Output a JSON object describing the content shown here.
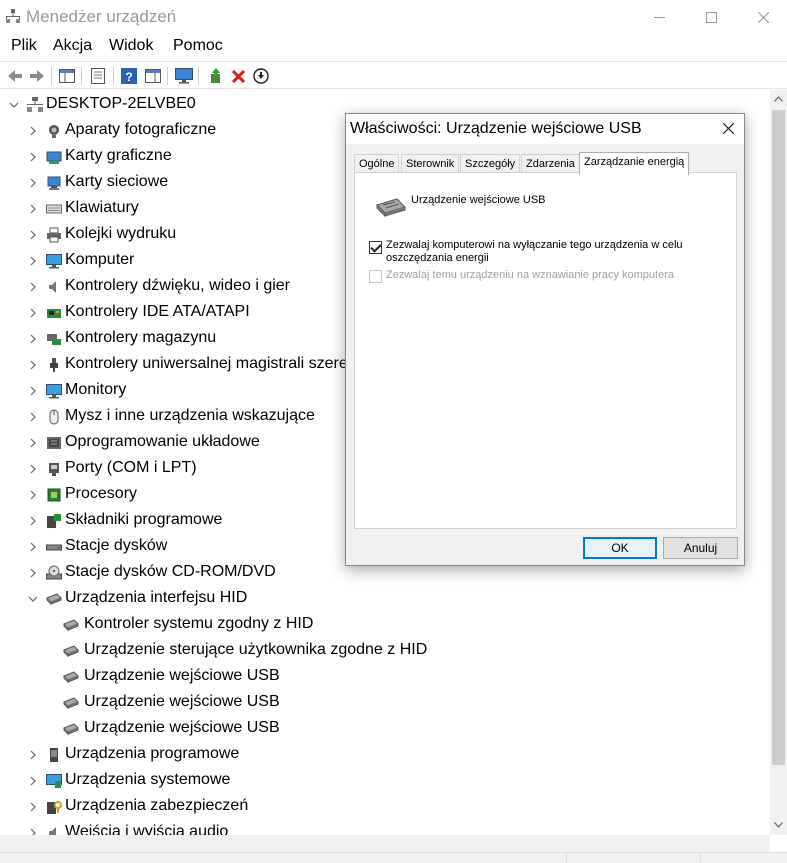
{
  "window": {
    "title": "Menedżer urządzeń"
  },
  "menu": {
    "items": [
      "Plik",
      "Akcja",
      "Widok",
      "Pomoc"
    ]
  },
  "toolbar": {
    "buttons": [
      "back-icon",
      "forward-icon",
      "show-hide-console-tree-icon",
      "properties-icon",
      "help-icon",
      "action-pane-icon",
      "monitor-icon",
      "update-driver-icon",
      "uninstall-icon",
      "download-icon"
    ]
  },
  "tree": {
    "root": "DESKTOP-2ELVBE0",
    "categories": [
      {
        "label": "Aparaty fotograficzne",
        "icon": "camera-icon"
      },
      {
        "label": "Karty graficzne",
        "icon": "display-adapter-icon"
      },
      {
        "label": "Karty sieciowe",
        "icon": "network-adapter-icon"
      },
      {
        "label": "Klawiatury",
        "icon": "keyboard-icon"
      },
      {
        "label": "Kolejki wydruku",
        "icon": "printer-icon"
      },
      {
        "label": "Komputer",
        "icon": "computer-icon"
      },
      {
        "label": "Kontrolery dźwięku, wideo i gier",
        "icon": "speaker-icon"
      },
      {
        "label": "Kontrolery IDE ATA/ATAPI",
        "icon": "ide-controller-icon"
      },
      {
        "label": "Kontrolery magazynu",
        "icon": "storage-controller-icon"
      },
      {
        "label": "Kontrolery uniwersalnej magistrali szeregowej",
        "icon": "usb-plug-icon"
      },
      {
        "label": "Monitory",
        "icon": "monitor-icon"
      },
      {
        "label": "Mysz i inne urządzenia wskazujące",
        "icon": "mouse-icon"
      },
      {
        "label": "Oprogramowanie układowe",
        "icon": "firmware-icon"
      },
      {
        "label": "Porty (COM i LPT)",
        "icon": "port-icon"
      },
      {
        "label": "Procesory",
        "icon": "processor-icon"
      },
      {
        "label": "Składniki programowe",
        "icon": "software-component-icon"
      },
      {
        "label": "Stacje dysków",
        "icon": "disk-drive-icon"
      },
      {
        "label": "Stacje dysków CD-ROM/DVD",
        "icon": "cdrom-icon"
      },
      {
        "label": "Urządzenia interfejsu HID",
        "icon": "hid-icon",
        "expanded": true,
        "children": [
          "Kontroler systemu zgodny z HID",
          "Urządzenie sterujące użytkownika zgodne z HID",
          "Urządzenie wejściowe USB",
          "Urządzenie wejściowe USB",
          "Urządzenie wejściowe USB"
        ]
      },
      {
        "label": "Urządzenia programowe",
        "icon": "software-device-icon"
      },
      {
        "label": "Urządzenia systemowe",
        "icon": "system-device-icon"
      },
      {
        "label": "Urządzenia zabezpieczeń",
        "icon": "security-device-icon"
      },
      {
        "label": "Wejścia i wyjścia audio",
        "icon": "audio-io-icon"
      }
    ]
  },
  "dialog": {
    "title": "Właściwości: Urządzenie wejściowe USB",
    "tabs": [
      "Ogólne",
      "Sterownik",
      "Szczegóły",
      "Zdarzenia",
      "Zarządzanie energią"
    ],
    "active_tab": "Zarządzanie energią",
    "device_name": "Urządzenie wejściowe USB",
    "options": [
      {
        "label": "Zezwalaj komputerowi na wyłączanie tego urządzenia w celu oszczędzania energii",
        "checked": true,
        "enabled": true
      },
      {
        "label": "Zezwalaj temu urządzeniu na wznawianie pracy komputera",
        "checked": false,
        "enabled": false
      }
    ],
    "ok_label": "OK",
    "cancel_label": "Anuluj"
  },
  "colors": {
    "accent": "#0078d7",
    "disabled_text": "#a0a0a0",
    "title_inactive": "#999999"
  }
}
